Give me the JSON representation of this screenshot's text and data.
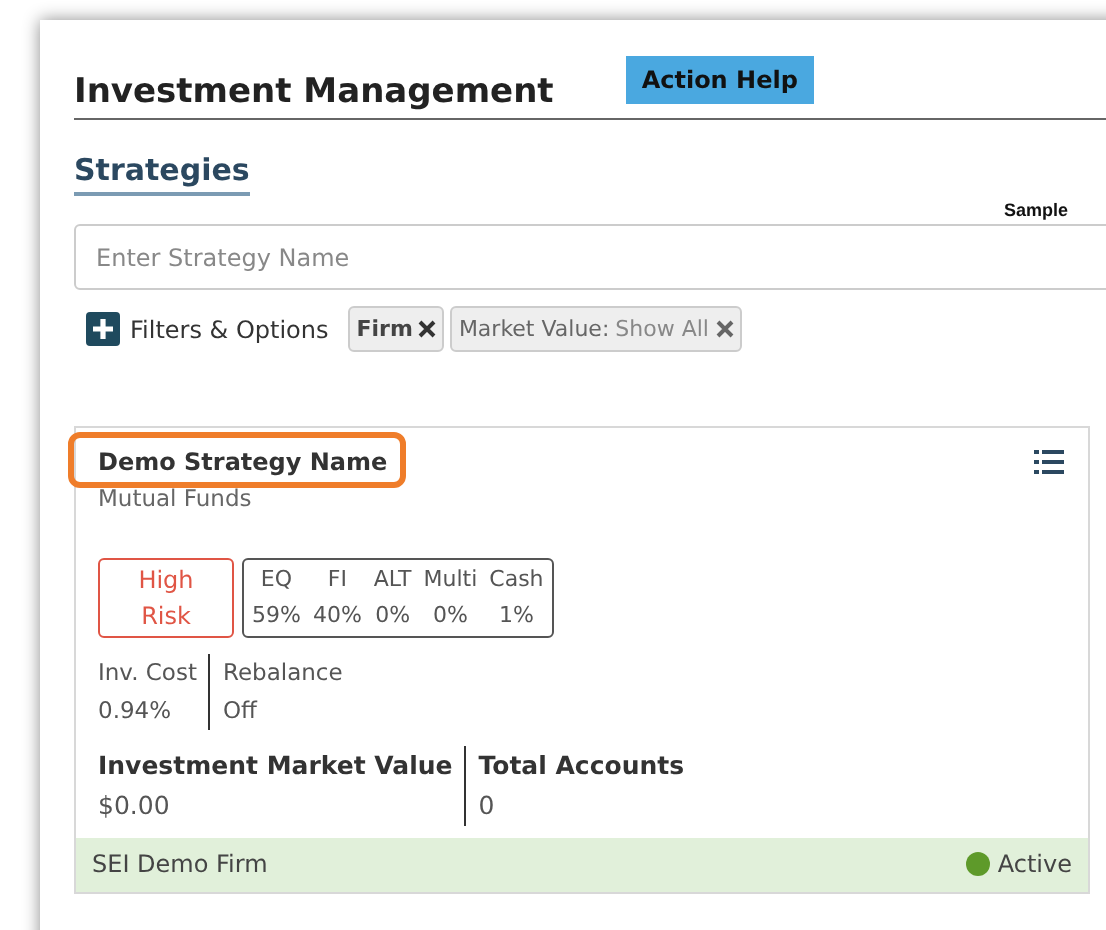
{
  "header": {
    "title": "Investment Management",
    "help_button": "Action Help"
  },
  "section": {
    "title": "Strategies",
    "note": "Sample"
  },
  "search": {
    "placeholder": "Enter Strategy Name"
  },
  "filters": {
    "label": "Filters & Options",
    "chips": [
      {
        "label": "Firm"
      },
      {
        "label": "Market Value:",
        "value": "Show All"
      }
    ]
  },
  "strategy": {
    "name": "Demo Strategy Name",
    "highlighted": true,
    "type": "Mutual Funds",
    "risk": "High Risk",
    "allocation": [
      {
        "label": "EQ",
        "value": "59%"
      },
      {
        "label": "FI",
        "value": "40%"
      },
      {
        "label": "ALT",
        "value": "0%"
      },
      {
        "label": "Multi",
        "value": "0%"
      },
      {
        "label": "Cash",
        "value": "1%"
      }
    ],
    "details": [
      {
        "label": "Inv. Cost",
        "value": "0.94%"
      },
      {
        "label": "Rebalance",
        "value": "Off"
      }
    ],
    "totals": [
      {
        "label": "Investment Market Value",
        "value": "$0.00"
      },
      {
        "label": "Total Accounts",
        "value": "0"
      }
    ],
    "firm": "SEI Demo Firm",
    "status": {
      "label": "Active",
      "color": "#5e9a2a"
    }
  }
}
